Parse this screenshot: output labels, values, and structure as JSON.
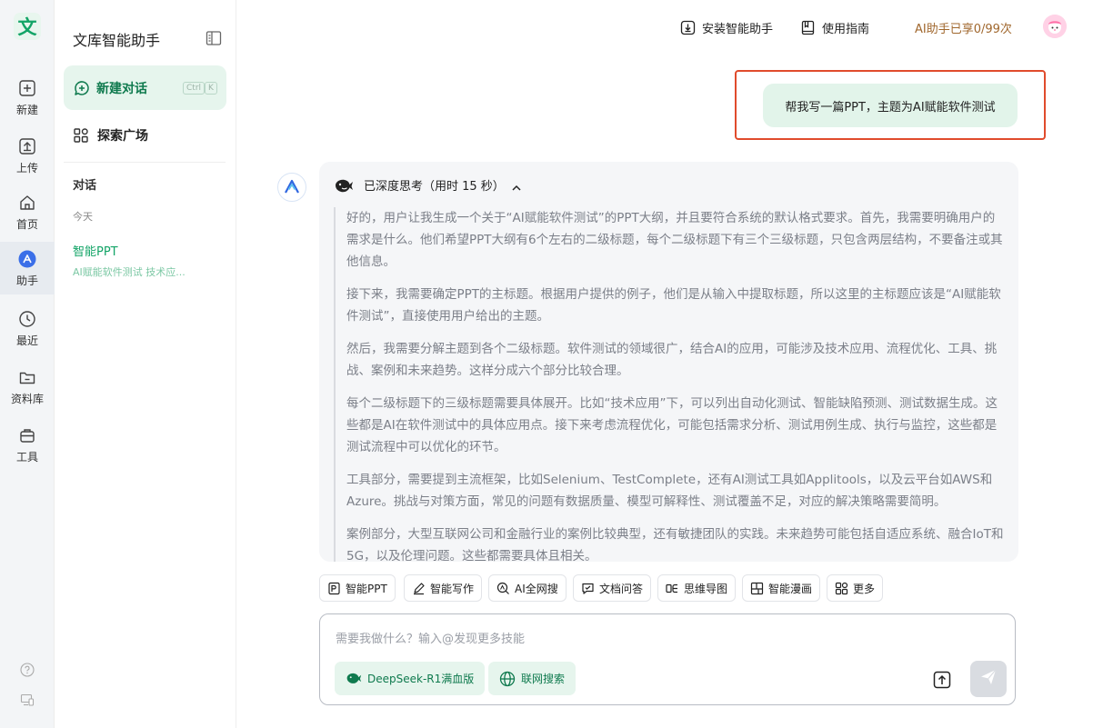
{
  "app": {
    "logo_char": "文",
    "brand_color": "#13a467"
  },
  "rail": {
    "items": [
      {
        "label": "新建",
        "icon": "plus-icon"
      },
      {
        "label": "上传",
        "icon": "upload-icon"
      },
      {
        "label": "首页",
        "icon": "home-icon"
      },
      {
        "label": "助手",
        "icon": "assistant-icon",
        "active": true
      },
      {
        "label": "最近",
        "icon": "clock-icon"
      },
      {
        "label": "资料库",
        "icon": "folder-icon"
      },
      {
        "label": "工具",
        "icon": "toolbox-icon"
      }
    ],
    "bottom_icons": [
      "help-icon",
      "device-icon"
    ]
  },
  "sidebar": {
    "title": "文库智能助手",
    "new_chat": {
      "label": "新建对话",
      "shortcut_1": "Ctrl",
      "shortcut_2": "K"
    },
    "explore": {
      "label": "探索广场"
    },
    "section_title": "对话",
    "date_group": "今天",
    "conversations": [
      {
        "title": "智能PPT",
        "subtitle": "AI赋能软件测试 技术应..."
      }
    ]
  },
  "topbar": {
    "install": "安装智能助手",
    "guide": "使用指南",
    "quota": "AI助手已享0/99次"
  },
  "chat": {
    "user_message": "帮我写一篇PPT，主题为AI赋能软件测试",
    "think_header": "已深度思考（用时 15 秒）",
    "think_paragraphs": [
      "好的，用户让我生成一个关于“AI赋能软件测试”的PPT大纲，并且要符合系统的默认格式要求。首先，我需要明确用户的需求是什么。他们希望PPT大纲有6个左右的二级标题，每个二级标题下有三个三级标题，只包含两层结构，不要备注或其他信息。",
      "接下来，我需要确定PPT的主标题。根据用户提供的例子，他们是从输入中提取标题，所以这里的主标题应该是“AI赋能软件测试”，直接使用用户给出的主题。",
      "然后，我需要分解主题到各个二级标题。软件测试的领域很广，结合AI的应用，可能涉及技术应用、流程优化、工具、挑战、案例和未来趋势。这样分成六个部分比较合理。",
      "每个二级标题下的三级标题需要具体展开。比如“技术应用”下，可以列出自动化测试、智能缺陷预测、测试数据生成。这些都是AI在软件测试中的具体应用点。接下来考虑流程优化，可能包括需求分析、测试用例生成、执行与监控，这些都是测试流程中可以优化的环节。",
      "工具部分，需要提到主流框架，比如Selenium、TestComplete，还有AI测试工具如Applitools，以及云平台如AWS和Azure。挑战与对策方面，常见的问题有数据质量、模型可解释性、测试覆盖不足，对应的解决策略需要简明。",
      "案例部分，大型互联网公司和金融行业的案例比较典型，还有敏捷团队的实践。未来趋势可能包括自适应系统、融合IoT和5G，以及伦理问题。这些都需要具体且相关。"
    ]
  },
  "tools": [
    {
      "label": "智能PPT",
      "icon": "ppt-icon"
    },
    {
      "label": "智能写作",
      "icon": "pen-icon"
    },
    {
      "label": "AI全网搜",
      "icon": "ai-search-icon"
    },
    {
      "label": "文档问答",
      "icon": "doc-chat-icon"
    },
    {
      "label": "思维导图",
      "icon": "mindmap-icon"
    },
    {
      "label": "智能漫画",
      "icon": "comic-icon"
    },
    {
      "label": "更多",
      "icon": "grid-icon"
    }
  ],
  "input": {
    "placeholder": "需要我做什么？输入@发现更多技能",
    "model_chip": "DeepSeek-R1满血版",
    "web_chip": "联网搜索"
  }
}
